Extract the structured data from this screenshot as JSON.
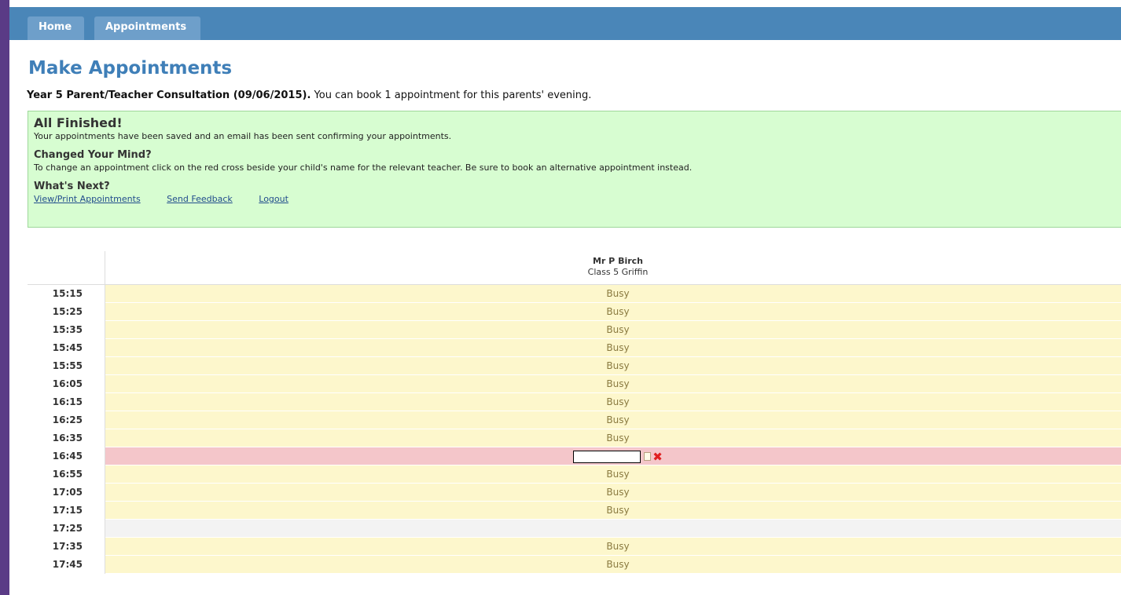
{
  "nav": {
    "tabs": [
      {
        "label": "Home"
      },
      {
        "label": "Appointments"
      }
    ]
  },
  "page": {
    "title": "Make Appointments",
    "intro_bold": "Year 5 Parent/Teacher Consultation (09/06/2015).",
    "intro_rest": " You can book 1 appointment for this parents' evening."
  },
  "notice": {
    "heading": "All Finished!",
    "saved_text": "Your appointments have been saved and an email has been sent confirming your appointments.",
    "changed_heading": "Changed Your Mind?",
    "changed_text": "To change an appointment click on the red cross beside your child's name for the relevant teacher. Be sure to book an alternative appointment instead.",
    "next_heading": "What's Next?",
    "links": [
      "View/Print Appointments",
      "Send Feedback",
      "Logout"
    ]
  },
  "schedule": {
    "teacher_name": "Mr P Birch",
    "teacher_class": "Class 5 Griffin",
    "colors": {
      "busy": "#fdf7cc",
      "booked": "#f4c6ca",
      "free": "#f3f3f3"
    },
    "slots": [
      {
        "time": "15:15",
        "status": "busy",
        "label": "Busy"
      },
      {
        "time": "15:25",
        "status": "busy",
        "label": "Busy"
      },
      {
        "time": "15:35",
        "status": "busy",
        "label": "Busy"
      },
      {
        "time": "15:45",
        "status": "busy",
        "label": "Busy"
      },
      {
        "time": "15:55",
        "status": "busy",
        "label": "Busy"
      },
      {
        "time": "16:05",
        "status": "busy",
        "label": "Busy"
      },
      {
        "time": "16:15",
        "status": "busy",
        "label": "Busy"
      },
      {
        "time": "16:25",
        "status": "busy",
        "label": "Busy"
      },
      {
        "time": "16:35",
        "status": "busy",
        "label": "Busy"
      },
      {
        "time": "16:45",
        "status": "booked",
        "label": ""
      },
      {
        "time": "16:55",
        "status": "busy",
        "label": "Busy"
      },
      {
        "time": "17:05",
        "status": "busy",
        "label": "Busy"
      },
      {
        "time": "17:15",
        "status": "busy",
        "label": "Busy"
      },
      {
        "time": "17:25",
        "status": "free",
        "label": ""
      },
      {
        "time": "17:35",
        "status": "busy",
        "label": "Busy"
      },
      {
        "time": "17:45",
        "status": "busy",
        "label": "Busy"
      }
    ]
  }
}
